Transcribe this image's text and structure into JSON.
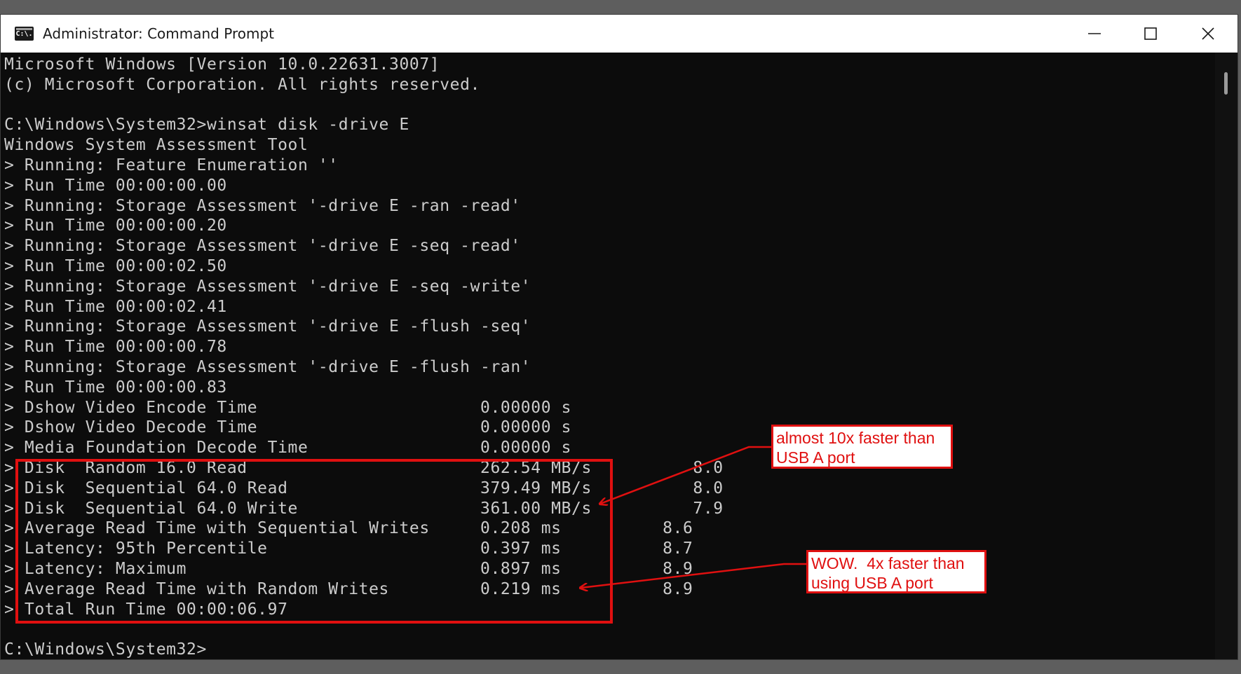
{
  "window": {
    "title": "Administrator: Command Prompt",
    "icon": "command-prompt-icon",
    "icon_text": "C:\\.",
    "controls": [
      "minimize-icon",
      "maximize-icon",
      "close-icon"
    ]
  },
  "console": {
    "lines": [
      "Microsoft Windows [Version 10.0.22631.3007]",
      "(c) Microsoft Corporation. All rights reserved.",
      "",
      "C:\\Windows\\System32>winsat disk -drive E",
      "Windows System Assessment Tool",
      "> Running: Feature Enumeration ''",
      "> Run Time 00:00:00.00",
      "> Running: Storage Assessment '-drive E -ran -read'",
      "> Run Time 00:00:00.20",
      "> Running: Storage Assessment '-drive E -seq -read'",
      "> Run Time 00:00:02.50",
      "> Running: Storage Assessment '-drive E -seq -write'",
      "> Run Time 00:00:02.41",
      "> Running: Storage Assessment '-drive E -flush -seq'",
      "> Run Time 00:00:00.78",
      "> Running: Storage Assessment '-drive E -flush -ran'",
      "> Run Time 00:00:00.83",
      "> Dshow Video Encode Time                      0.00000 s",
      "> Dshow Video Decode Time                      0.00000 s",
      "> Media Foundation Decode Time                 0.00000 s",
      "> Disk  Random 16.0 Read                       262.54 MB/s          8.0",
      "> Disk  Sequential 64.0 Read                   379.49 MB/s          8.0",
      "> Disk  Sequential 64.0 Write                  361.00 MB/s          7.9",
      "> Average Read Time with Sequential Writes     0.208 ms          8.6",
      "> Latency: 95th Percentile                     0.397 ms          8.7",
      "> Latency: Maximum                             0.897 ms          8.9",
      "> Average Read Time with Random Writes         0.219 ms          8.9",
      "> Total Run Time 00:00:06.97",
      "",
      "C:\\Windows\\System32>"
    ]
  },
  "annotations": {
    "callout_1": "almost 10x faster than\nUSB A port",
    "callout_2": "WOW.  4x faster than\nusing USB A port",
    "color": "#e01010"
  }
}
